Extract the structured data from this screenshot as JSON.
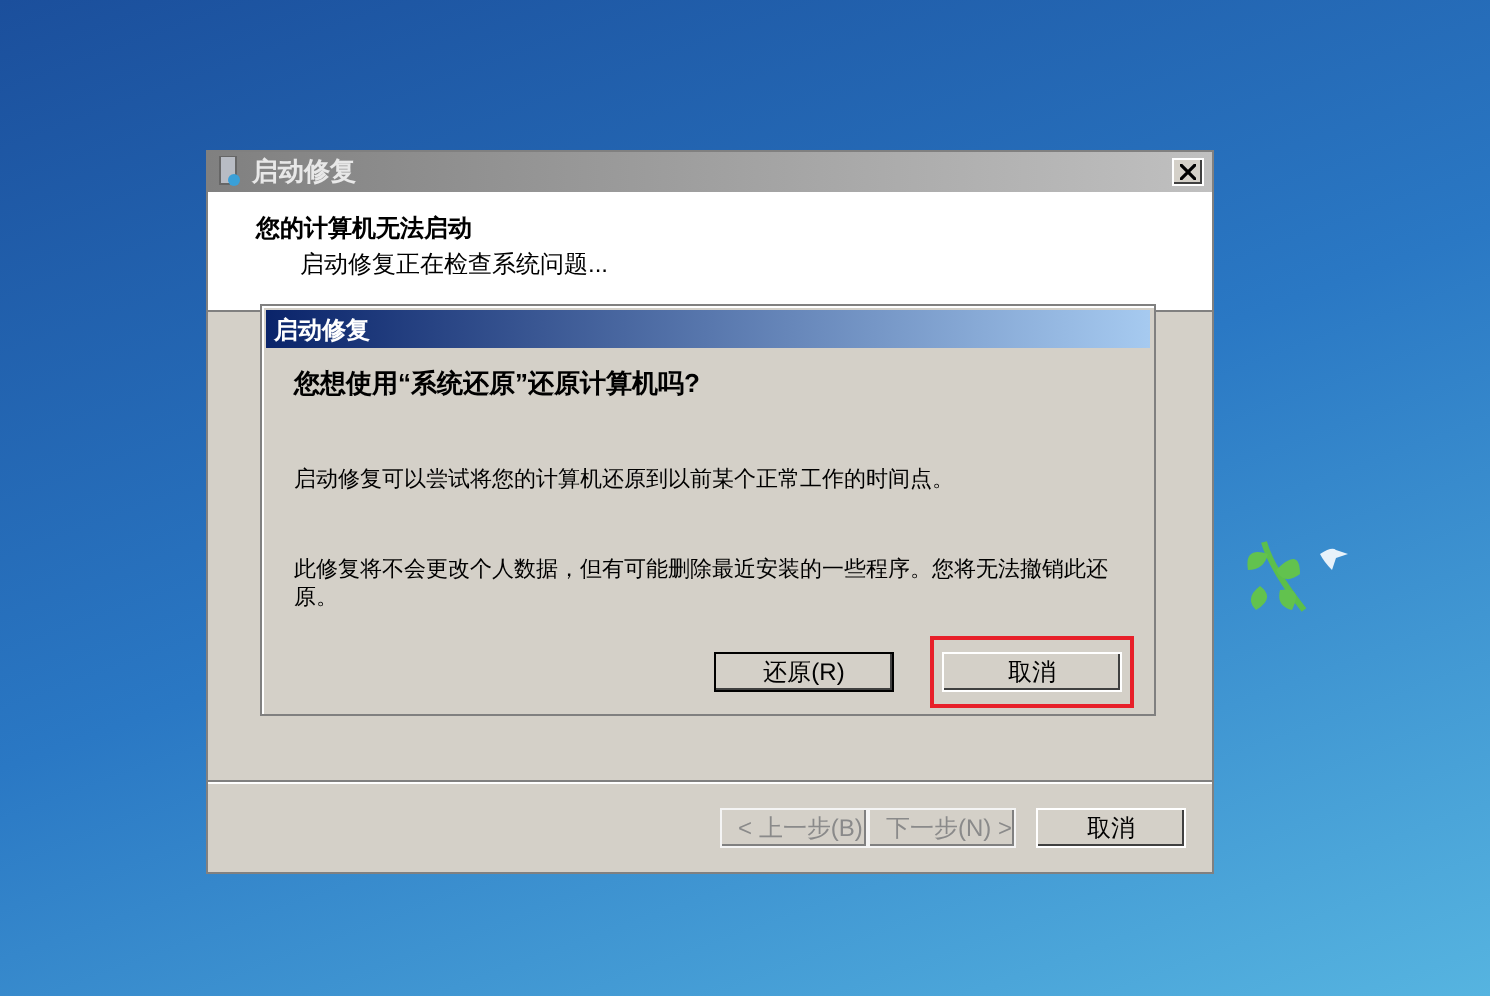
{
  "window": {
    "title": "启动修复",
    "heading": "您的计算机无法启动",
    "status": "启动修复正在检查系统问题...",
    "buttons": [
      {
        "label": "< 上一步(B)",
        "disabled": true
      },
      {
        "label": "下一步(N) >",
        "disabled": true
      },
      {
        "label": "取消",
        "disabled": false
      }
    ]
  },
  "dialog": {
    "title": "启动修复",
    "question": "您想使用“系统还原”还原计算机吗?",
    "message": "启动修复可以尝试将您的计算机还原到以前某个正常工作的时间点。",
    "warning": "此修复将不会更改个人数据，但有可能删除最近安装的一些程序。您将无法撤销此还原。",
    "buttons": [
      {
        "label": "还原(R)",
        "highlighted": false
      },
      {
        "label": "取消",
        "highlighted": true
      }
    ]
  }
}
